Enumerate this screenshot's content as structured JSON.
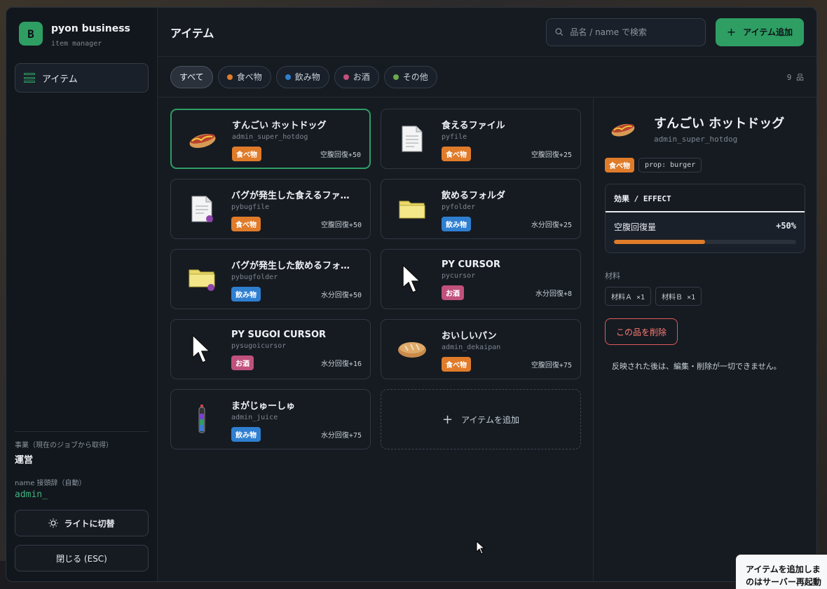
{
  "brand": {
    "logo": "B",
    "name": "pyon business",
    "sub": "item manager"
  },
  "nav": {
    "items_label": "アイテム"
  },
  "sidebar_meta": {
    "business_label": "事業（現在のジョブから取得）",
    "business_value": "運営",
    "prefix_label": "name 接頭辞（自動）",
    "prefix_value": "admin_"
  },
  "buttons": {
    "theme": "ライトに切替",
    "close": "閉じる (ESC)",
    "add_item": "アイテム追加",
    "add_card": "アイテムを追加",
    "delete": "この品を削除"
  },
  "header": {
    "title": "アイテム"
  },
  "search": {
    "placeholder": "品名 / name で検索"
  },
  "filters": [
    {
      "label": "すべて",
      "color": ""
    },
    {
      "label": "食べ物",
      "color": "#e07b2a"
    },
    {
      "label": "飲み物",
      "color": "#2f7fd1"
    },
    {
      "label": "お酒",
      "color": "#c0517c"
    },
    {
      "label": "その他",
      "color": "#6aa84f"
    }
  ],
  "count": "9 品",
  "items": [
    {
      "name": "すんごい ホットドッグ",
      "id": "admin_super_hotdog",
      "category": "食べ物",
      "effect": "空腹回復+50",
      "icon": "hotdog-icon"
    },
    {
      "name": "食えるファイル",
      "id": "pyfile",
      "category": "食べ物",
      "effect": "空腹回復+25",
      "icon": "file-icon"
    },
    {
      "name": "バグが発生した食えるファ…",
      "id": "pybugfile",
      "category": "食べ物",
      "effect": "空腹回復+50",
      "icon": "bug-file-icon"
    },
    {
      "name": "飲めるフォルダ",
      "id": "pyfolder",
      "category": "飲み物",
      "effect": "水分回復+25",
      "icon": "folder-icon"
    },
    {
      "name": "バグが発生した飲めるフォ…",
      "id": "pybugfolder",
      "category": "飲み物",
      "effect": "水分回復+50",
      "icon": "bug-folder-icon"
    },
    {
      "name": "PY CURSOR",
      "id": "pycursor",
      "category": "お酒",
      "effect": "水分回復+8",
      "icon": "cursor-icon"
    },
    {
      "name": "PY SUGOI CURSOR",
      "id": "pysugoicursor",
      "category": "お酒",
      "effect": "水分回復+16",
      "icon": "cursor-icon"
    },
    {
      "name": "おいしいパン",
      "id": "admin_dekaipan",
      "category": "食べ物",
      "effect": "空腹回復+75",
      "icon": "bread-icon"
    },
    {
      "name": "まがじゅーしゅ",
      "id": "admin_juice",
      "category": "飲み物",
      "effect": "水分回復+75",
      "icon": "juice-icon"
    }
  ],
  "detail": {
    "title": "すんごい ホットドッグ",
    "id": "admin_super_hotdog",
    "category": "食べ物",
    "prop": "prop: burger",
    "effect_header": "効果 / EFFECT",
    "effect_name": "空腹回復量",
    "effect_value": "+50%",
    "effect_fraction": 0.5,
    "materials_label": "材料",
    "materials": [
      "材料Ａ ×1",
      "材料Ｂ ×1"
    ],
    "note": "反映された後は、編集・削除が一切できません。"
  },
  "toast": {
    "line1": "アイテムを追加しま",
    "line2": "のはサーバー再起動"
  }
}
